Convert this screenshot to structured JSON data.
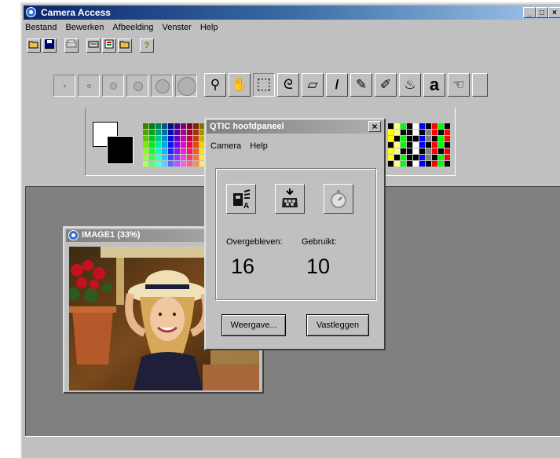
{
  "app": {
    "title": "Camera Access",
    "menu": [
      "Bestand",
      "Bewerken",
      "Afbeelding",
      "Venster",
      "Help"
    ]
  },
  "toolbar_icons": [
    "open-folder-icon",
    "save-disk-icon",
    "print-icon",
    "scanner-icon",
    "scan-folder-icon",
    "open-folder-icon",
    "help-icon"
  ],
  "help_glyph": "?",
  "tools": {
    "brushes": [
      "brush-size-1",
      "brush-size-2",
      "brush-size-3",
      "brush-size-4",
      "brush-size-5",
      "brush-size-6"
    ],
    "items": [
      {
        "name": "zoom-icon",
        "glyph": "⚲"
      },
      {
        "name": "hand-icon",
        "glyph": "✋"
      },
      {
        "name": "rect-select-icon",
        "glyph": "⬚"
      },
      {
        "name": "lasso-icon",
        "glyph": "ᘓ"
      },
      {
        "name": "eraser-icon",
        "glyph": "▱"
      },
      {
        "name": "brush-icon",
        "glyph": "/"
      },
      {
        "name": "pencil-icon",
        "glyph": "✎"
      },
      {
        "name": "eyedropper-icon",
        "glyph": "✐"
      },
      {
        "name": "fill-icon",
        "glyph": "♨"
      },
      {
        "name": "text-icon",
        "glyph": "a"
      },
      {
        "name": "smudge-icon",
        "glyph": "☜"
      }
    ]
  },
  "image_window": {
    "title": "IMAGE1 (33%)"
  },
  "dialog": {
    "title": "QTIC hoofdpaneel",
    "close_glyph": "×",
    "menu": [
      "Camera",
      "Help"
    ],
    "icons": [
      "camera-settings-icon",
      "capture-icon",
      "timer-icon"
    ],
    "remaining_label": "Overgebleven:",
    "remaining_value": "16",
    "used_label": "Gebruikt:",
    "used_value": "10",
    "view_button": "Weergave...",
    "capture_button": "Vastleggen"
  },
  "colors": {
    "title_active": "#0a246a",
    "workspace": "#808080",
    "face": "#c0c0c0"
  }
}
